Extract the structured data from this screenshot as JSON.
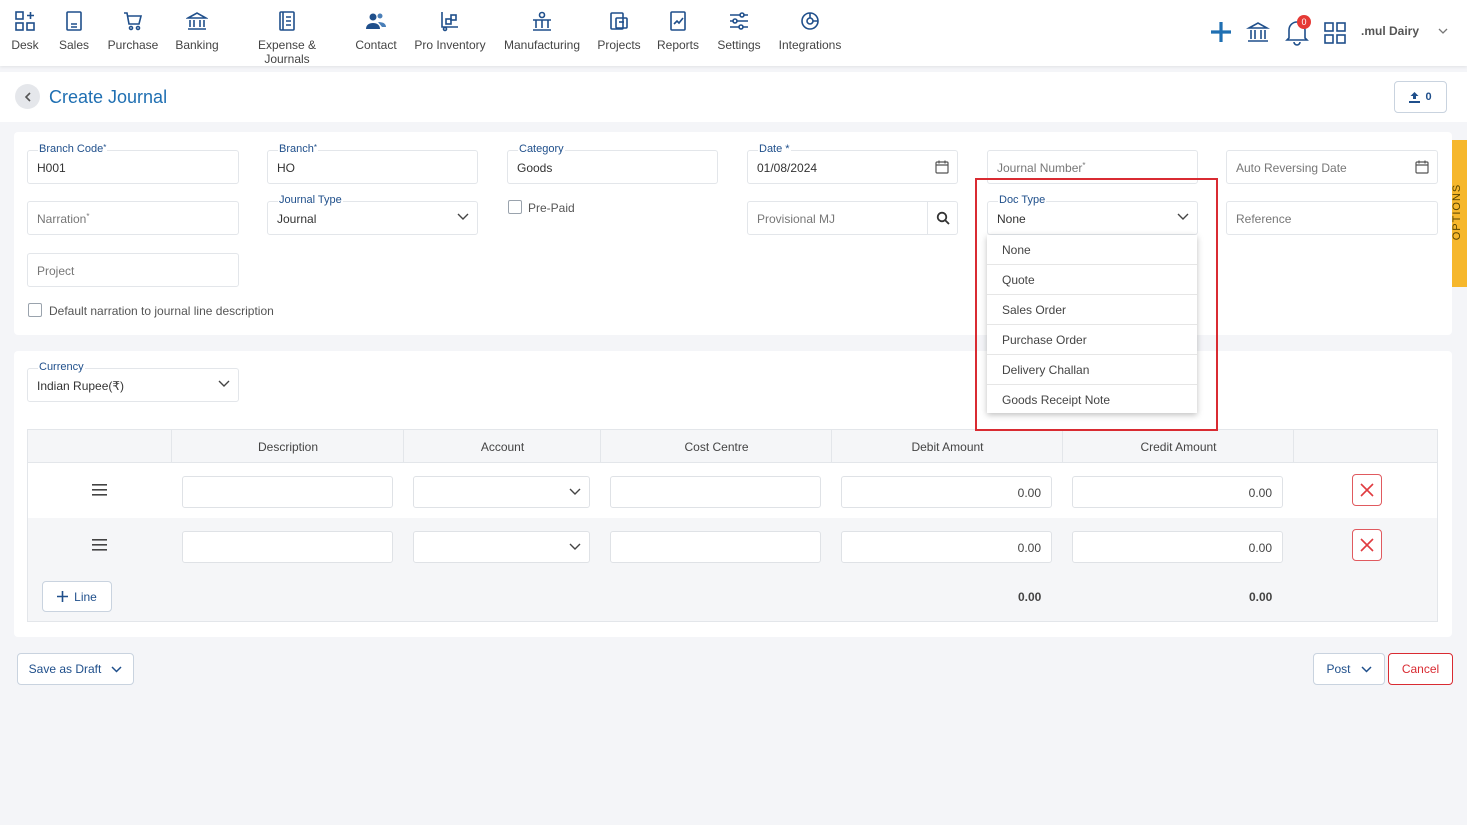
{
  "nav": {
    "items": [
      {
        "label": "Desk",
        "icon": "desk-icon"
      },
      {
        "label": "Sales",
        "icon": "sales-icon"
      },
      {
        "label": "Purchase",
        "icon": "cart-icon"
      },
      {
        "label": "Banking",
        "icon": "bank-icon"
      },
      {
        "label": "Expense & Journals",
        "icon": "journal-icon"
      },
      {
        "label": "Contact",
        "icon": "contacts-icon"
      },
      {
        "label": "Pro Inventory",
        "icon": "inventory-icon"
      },
      {
        "label": "Manufacturing",
        "icon": "manufacturing-icon"
      },
      {
        "label": "Projects",
        "icon": "projects-icon"
      },
      {
        "label": "Reports",
        "icon": "reports-icon"
      },
      {
        "label": "Settings",
        "icon": "settings-icon"
      },
      {
        "label": "Integrations",
        "icon": "integrations-icon"
      }
    ],
    "notification_count": "0",
    "company_name": ".mul Dairy"
  },
  "header": {
    "title": "Create Journal",
    "upload_count": "0"
  },
  "form": {
    "branch_code": {
      "label": "Branch Code",
      "value": "H001"
    },
    "branch": {
      "label": "Branch",
      "value": "HO"
    },
    "category": {
      "label": "Category",
      "value": "Goods"
    },
    "date": {
      "label": "Date *",
      "value": "01/08/2024"
    },
    "journal_number": {
      "placeholder": "Journal Number"
    },
    "auto_reversing_date": {
      "placeholder": "Auto Reversing Date"
    },
    "narration": {
      "placeholder": "Narration"
    },
    "journal_type": {
      "label": "Journal Type",
      "value": "Journal"
    },
    "pre_paid": {
      "label": "Pre-Paid"
    },
    "provisional_mj": {
      "placeholder": "Provisional MJ"
    },
    "doc_type": {
      "label": "Doc Type",
      "value": "None",
      "options": [
        "None",
        "Quote",
        "Sales Order",
        "Purchase Order",
        "Delivery Challan",
        "Goods Receipt Note"
      ]
    },
    "reference": {
      "placeholder": "Reference"
    },
    "project": {
      "placeholder": "Project"
    },
    "default_narration": {
      "label": "Default narration to journal line description"
    }
  },
  "options_tab": {
    "label": "OPTIONS"
  },
  "lines": {
    "currency": {
      "label": "Currency",
      "value": "Indian Rupee(₹)"
    },
    "columns": [
      "Description",
      "Account",
      "Cost Centre",
      "Debit Amount",
      "Credit Amount"
    ],
    "rows": [
      {
        "debit": "0.00",
        "credit": "0.00"
      },
      {
        "debit": "0.00",
        "credit": "0.00"
      }
    ],
    "add_line_label": "Line",
    "total_debit": "0.00",
    "total_credit": "0.00"
  },
  "footer": {
    "save_draft_label": "Save as Draft",
    "post_label": "Post",
    "cancel_label": "Cancel"
  },
  "colors": {
    "accent": "#1f6fb2",
    "highlight": "#d92b32",
    "options_tab": "#f6b72c"
  }
}
